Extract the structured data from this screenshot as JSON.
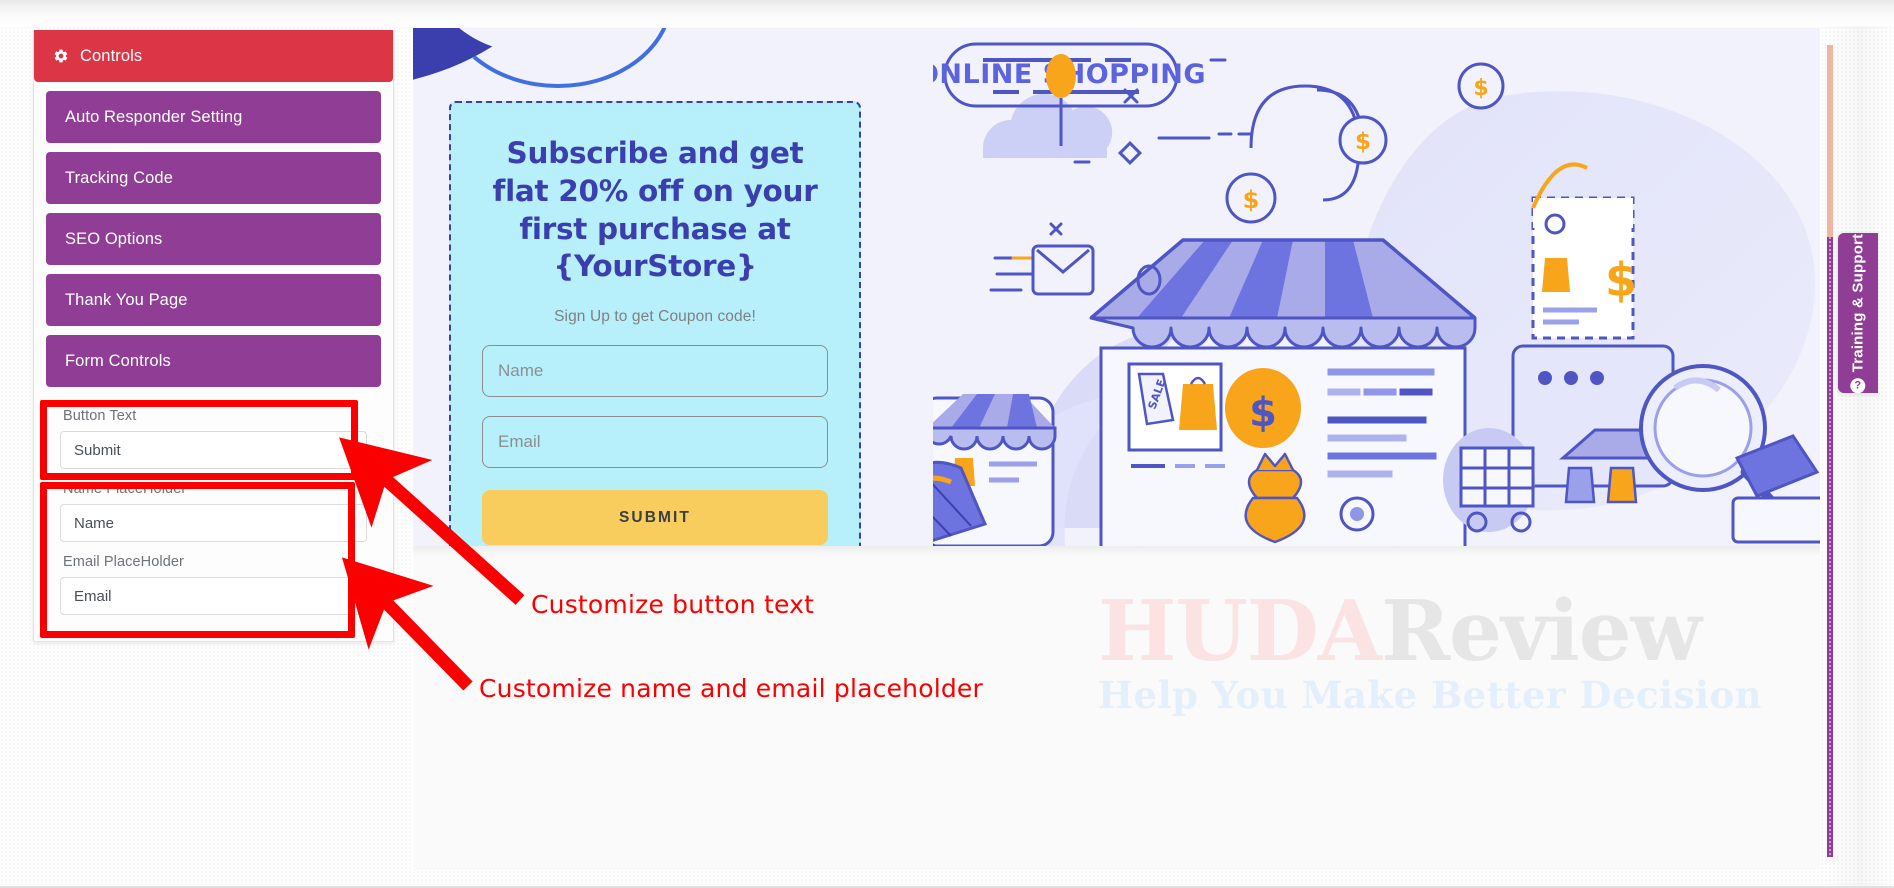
{
  "sidebar": {
    "accordion": [
      {
        "label": "Controls",
        "icon": "gear-icon",
        "state": "active",
        "color": "#dc3545"
      },
      {
        "label": "Auto Responder Setting",
        "color": "#8f3d95"
      },
      {
        "label": "Tracking Code",
        "color": "#8f3d95"
      },
      {
        "label": "SEO Options",
        "color": "#8f3d95"
      },
      {
        "label": "Thank You Page",
        "color": "#8f3d95"
      },
      {
        "label": "Form Controls",
        "color": "#8f3d95",
        "state": "expanded"
      }
    ],
    "form_controls": {
      "button_text": {
        "label": "Button Text",
        "value": "Submit"
      },
      "name_placeholder": {
        "label": "Name PlaceHolder",
        "value": "Name"
      },
      "email_placeholder": {
        "label": "Email PlaceHolder",
        "value": "Email"
      }
    }
  },
  "preview": {
    "card": {
      "title": "Subscribe and get flat 20% off on your first purchase at {YourStore}",
      "subtitle": "Sign Up to get Coupon code!",
      "name_field_placeholder": "Name",
      "email_field_placeholder": "Email",
      "submit_label": "SUBMIT"
    },
    "illustration": {
      "badge_label": "ONLINE SHOPPING",
      "sale_tag_label": "SALE"
    }
  },
  "annotations": [
    {
      "text": "Customize button text"
    },
    {
      "text": "Customize name and email placeholder"
    }
  ],
  "support_tab": {
    "label": "Training & Support",
    "icon": "question-circle-icon"
  },
  "watermark": {
    "brand_part1": "HUDA",
    "brand_part2": "Review",
    "tagline": "Help You Make Better Decision"
  },
  "colors": {
    "accent_red": "#dc3545",
    "accent_purple": "#8f3d95",
    "annotation_red": "#fb0000",
    "card_bg": "#b7f0fb",
    "card_text": "#3b3fae",
    "submit_bg": "#f8cd5d"
  }
}
